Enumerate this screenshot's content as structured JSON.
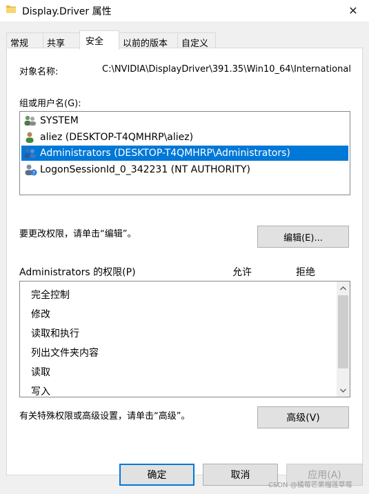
{
  "window": {
    "title": "Display.Driver 属性",
    "close_glyph": "✕"
  },
  "tabs": [
    {
      "label": "常规",
      "active": false
    },
    {
      "label": "共享",
      "active": false
    },
    {
      "label": "安全",
      "active": true
    },
    {
      "label": "以前的版本",
      "active": false
    },
    {
      "label": "自定义",
      "active": false
    }
  ],
  "security": {
    "object_name_label": "对象名称:",
    "object_name_value": "C:\\NVIDIA\\DisplayDriver\\391.35\\Win10_64\\International",
    "group_users_label": "组或用户名(G):",
    "users": [
      {
        "name": "SYSTEM",
        "icon": "system-group-icon",
        "selected": false
      },
      {
        "name": "aliez (DESKTOP-T4QMHRP\\aliez)",
        "icon": "user-icon",
        "selected": false
      },
      {
        "name": "Administrators (DESKTOP-T4QMHRP\\Administrators)",
        "icon": "group-icon",
        "selected": true
      },
      {
        "name": "LogonSessionId_0_342231 (NT AUTHORITY)",
        "icon": "unknown-user-icon",
        "selected": false
      }
    ],
    "change_hint": "要更改权限，请单击“编辑”。",
    "edit_button": "编辑(E)...",
    "permissions_for_label": "Administrators 的权限(P)",
    "allow_header": "允许",
    "deny_header": "拒绝",
    "permissions": [
      "完全控制",
      "修改",
      "读取和执行",
      "列出文件夹内容",
      "读取",
      "写入"
    ],
    "advanced_hint": "有关特殊权限或高级设置，请单击“高级”。",
    "advanced_button": "高级(V)"
  },
  "footer": {
    "ok_button": "确定",
    "cancel_button": "取消",
    "apply_button": "应用(A)"
  },
  "watermark": "CSDN @橘莓芒果榴莲草莓",
  "colors": {
    "selection": "#0078d7",
    "dialog_bg": "#f0f0f0",
    "folder": "#e8b93f"
  }
}
